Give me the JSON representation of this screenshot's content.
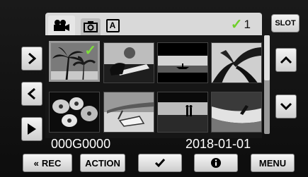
{
  "tabs": {
    "video_icon": "video-camera-icon",
    "photo_icon": "camera-icon",
    "auto_label": "A",
    "selected_count": "1"
  },
  "slot_label": "SLOT",
  "thumbnails": [
    {
      "name": "palm-trees-beach",
      "selected": true
    },
    {
      "name": "person-reading-on-bench",
      "selected": false
    },
    {
      "name": "boat-at-sunset",
      "selected": false
    },
    {
      "name": "palm-leaves-silhouette",
      "selected": false
    },
    {
      "name": "orchids-flowers",
      "selected": false
    },
    {
      "name": "beach-lounge-chair",
      "selected": false
    },
    {
      "name": "couple-at-sunset",
      "selected": false
    },
    {
      "name": "beach-waves",
      "selected": false
    }
  ],
  "file_name": "000G0000",
  "date": "2018-01-01",
  "bottom_bar": {
    "rec_label": "REC",
    "action_label": "ACTION",
    "menu_label": "MENU"
  },
  "colors": {
    "check_green": "#7ee03a",
    "button_face": "#e6e6e6"
  }
}
